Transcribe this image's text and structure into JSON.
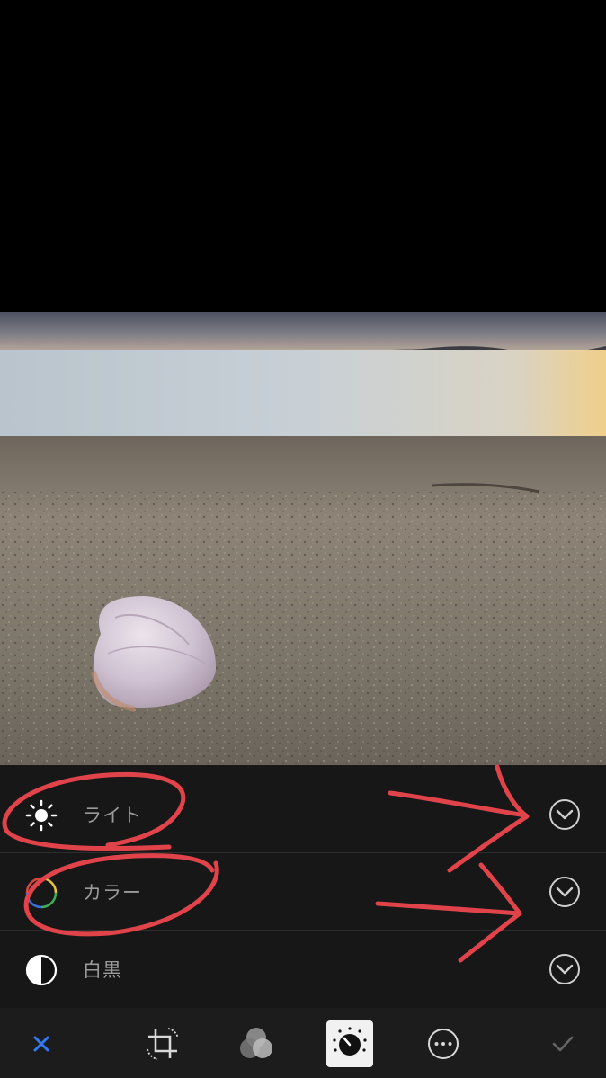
{
  "adjustments": {
    "items": [
      {
        "label": "ライト",
        "icon": "sun-icon",
        "expand_icon": "chevron-down-circle-icon"
      },
      {
        "label": "カラー",
        "icon": "color-ring-icon",
        "expand_icon": "chevron-down-circle-icon"
      },
      {
        "label": "白黒",
        "icon": "half-circle-icon",
        "expand_icon": "chevron-down-circle-icon"
      }
    ]
  },
  "toolbar": {
    "items": [
      {
        "name": "cancel",
        "icon": "close-icon",
        "color": "#3478f6"
      },
      {
        "name": "crop",
        "icon": "crop-rotate-icon"
      },
      {
        "name": "filters",
        "icon": "filters-icon"
      },
      {
        "name": "adjust",
        "icon": "adjust-dial-icon",
        "active": true
      },
      {
        "name": "more",
        "icon": "more-icon"
      },
      {
        "name": "done",
        "icon": "checkmark-icon"
      }
    ]
  },
  "colors": {
    "annotation": "#e0444a",
    "accent": "#3478f6",
    "panel": "#171717",
    "label": "#9a9a9a"
  }
}
